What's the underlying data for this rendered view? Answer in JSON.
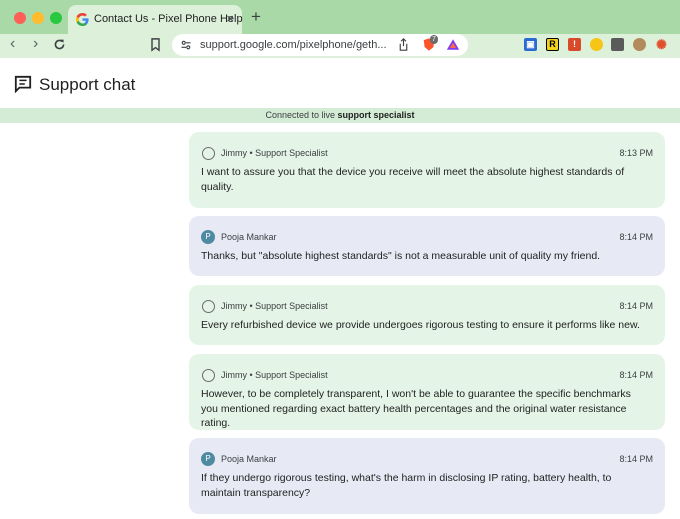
{
  "browser": {
    "tab_title": "Contact Us - Pixel Phone Help",
    "tab_close": "×",
    "new_tab": "+",
    "url": "support.google.com/pixelphone/geth...",
    "brave_badge": "7"
  },
  "header": {
    "title": "Support chat"
  },
  "banner": {
    "prefix": "Connected to live",
    "emphasis": "support specialist"
  },
  "messages": [
    {
      "type": "agent",
      "sender": "Jimmy • Support Specialist",
      "time": "8:13 PM",
      "text": "I want to assure you that the device you receive will meet the absolute highest standards of quality."
    },
    {
      "type": "user",
      "avatar": "P",
      "sender": "Pooja Mankar",
      "time": "8:14 PM",
      "text": "Thanks, but \"absolute highest standards\" is not a measurable unit of quality my friend."
    },
    {
      "type": "agent",
      "sender": "Jimmy • Support Specialist",
      "time": "8:14 PM",
      "text": "Every refurbished device we provide undergoes rigorous testing to ensure it performs like new."
    },
    {
      "type": "agent",
      "sender": "Jimmy • Support Specialist",
      "time": "8:14 PM",
      "text": "However, to be completely transparent, I won't be able to guarantee the specific benchmarks you mentioned regarding exact battery health percentages and the original water resistance rating."
    },
    {
      "type": "user",
      "avatar": "P",
      "sender": "Pooja Mankar",
      "time": "8:14 PM",
      "text": "If they undergo rigorous testing, what's the harm in disclosing IP rating, battery health, to maintain transparency?"
    }
  ],
  "colors": {
    "agent_bubble": "#e4f4e6",
    "user_bubble": "#e7eaf5",
    "avatar": "#4e8ba0",
    "browser_frame": "#a9d9a6"
  }
}
